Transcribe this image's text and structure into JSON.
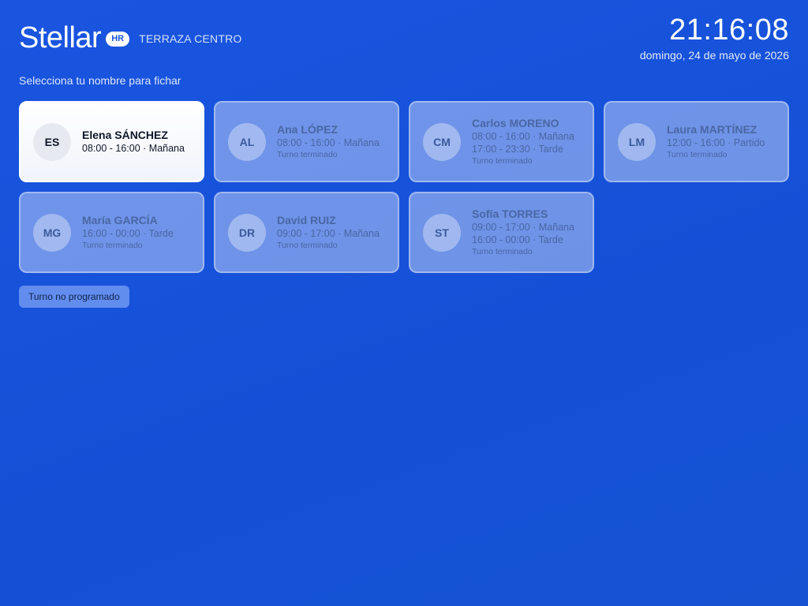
{
  "header": {
    "logo": "Stellar",
    "badge": "HR",
    "location": "TERRAZA CENTRO"
  },
  "clock": {
    "time": "21:16:08",
    "date": "domingo, 24 de mayo de 2026"
  },
  "instruction": "Selecciona tu nombre para fichar",
  "employees": [
    {
      "initials": "ES",
      "name": "Elena SÁNCHEZ",
      "shifts": [
        "08:00 - 16:00 · Mañana"
      ],
      "status": ""
    },
    {
      "initials": "AL",
      "name": "Ana LÓPEZ",
      "shifts": [
        "08:00 - 16:00 · Mañana"
      ],
      "status": "Turno terminado"
    },
    {
      "initials": "CM",
      "name": "Carlos MORENO",
      "shifts": [
        "08:00 - 16:00 · Mañana",
        "17:00 - 23:30 · Tarde"
      ],
      "status": "Turno terminado"
    },
    {
      "initials": "LM",
      "name": "Laura MARTÍNEZ",
      "shifts": [
        "12:00 - 16:00 · Partido"
      ],
      "status": "Turno terminado"
    },
    {
      "initials": "MG",
      "name": "María GARCÍA",
      "shifts": [
        "16:00 - 00:00 · Tarde"
      ],
      "status": "Turno terminado"
    },
    {
      "initials": "DR",
      "name": "David RUIZ",
      "shifts": [
        "09:00 - 17:00 · Mañana"
      ],
      "status": "Turno terminado"
    },
    {
      "initials": "ST",
      "name": "Sofía TORRES",
      "shifts": [
        "09:00 - 17:00 · Mañana",
        "16:00 - 00:00 · Tarde"
      ],
      "status": "Turno terminado"
    }
  ],
  "unscheduled_button": "Turno no programado",
  "colors": {
    "background": "#1a55e0",
    "card_active": "#ffffff",
    "card_inactive_text": "#4a67a4"
  }
}
